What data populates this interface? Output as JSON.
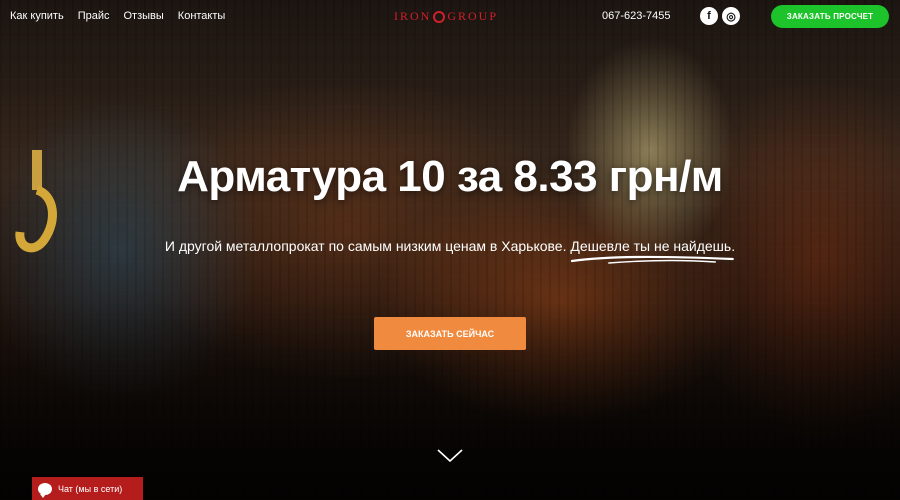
{
  "nav": {
    "items": [
      {
        "label": "Как купить"
      },
      {
        "label": "Прайс"
      },
      {
        "label": "Отзывы"
      },
      {
        "label": "Контакты"
      }
    ]
  },
  "logo": {
    "left": "IRON",
    "right": "GROUP"
  },
  "phone": "067-623-7455",
  "social": {
    "facebook": "f",
    "instagram": "◎"
  },
  "header_button": "ЗАКАЗАТЬ ПРОСЧЕТ",
  "hero": {
    "title": "Арматура 10 за 8.33 грн/м",
    "subtitle": "И другой металлопрокат по самым низким ценам в Харькове.",
    "subtitle_highlight": "Дешевле ты не найдешь.",
    "cta": "ЗАКАЗАТЬ СЕЙЧАС"
  },
  "chat": {
    "label": "Чат (мы в сети)"
  },
  "colors": {
    "accent_green": "#1dc32a",
    "accent_orange": "#f08a3e",
    "logo_red": "#d0202a",
    "chat_red": "#b51d1d"
  },
  "icons": [
    "facebook-icon",
    "instagram-icon",
    "chevron-down-icon",
    "chat-bubble-icon"
  ]
}
